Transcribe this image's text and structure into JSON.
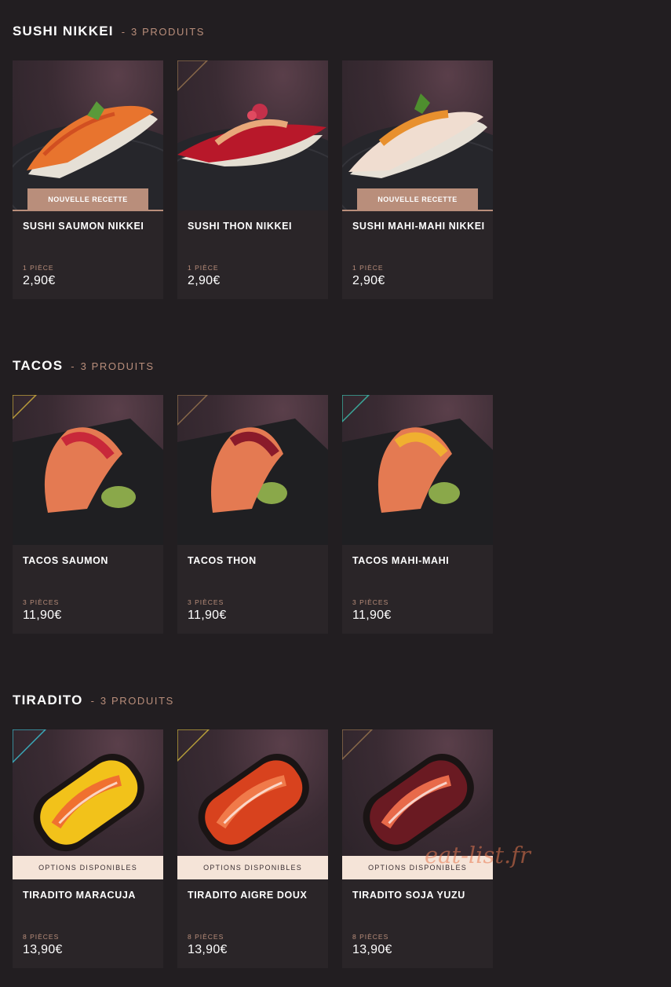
{
  "sections": [
    {
      "title": "SUSHI NIKKEI",
      "separator": "-",
      "count": "3 PRODUITS",
      "items": [
        {
          "name": "SUSHI SAUMON NIKKEI",
          "quantity": "1 PIÈCE",
          "price": "2,90€",
          "badge": "NOUVELLE RECETTE"
        },
        {
          "name": "SUSHI THON NIKKEI",
          "quantity": "1 PIÈCE",
          "price": "2,90€",
          "badge": ""
        },
        {
          "name": "SUSHI MAHI-MAHI NIKKEI",
          "quantity": "1 PIÈCE",
          "price": "2,90€",
          "badge": "NOUVELLE RECETTE"
        }
      ]
    },
    {
      "title": "TACOS",
      "separator": "-",
      "count": "3 PRODUITS",
      "items": [
        {
          "name": "TACOS SAUMON",
          "quantity": "3 PIÈCES",
          "price": "11,90€",
          "badge": ""
        },
        {
          "name": "TACOS THON",
          "quantity": "3 PIÈCES",
          "price": "11,90€",
          "badge": ""
        },
        {
          "name": "TACOS MAHI-MAHI",
          "quantity": "3 PIÈCES",
          "price": "11,90€",
          "badge": ""
        }
      ]
    },
    {
      "title": "TIRADITO",
      "separator": "-",
      "count": "3 PRODUITS",
      "items": [
        {
          "name": "TIRADITO MARACUJA",
          "quantity": "8 PIÈCES",
          "price": "13,90€",
          "badge": "OPTIONS DISPONIBLES"
        },
        {
          "name": "TIRADITO AIGRE DOUX",
          "quantity": "8 PIÈCES",
          "price": "13,90€",
          "badge": "OPTIONS DISPONIBLES"
        },
        {
          "name": "TIRADITO SOJA YUZU",
          "quantity": "8 PIÈCES",
          "price": "13,90€",
          "badge": "OPTIONS DISPONIBLES"
        }
      ]
    }
  ],
  "watermark": "eat-list.fr",
  "colors": {
    "background": "#221e21",
    "card": "#2a2528",
    "accent": "#b98e7b",
    "options_badge": "#f5e4d8"
  }
}
